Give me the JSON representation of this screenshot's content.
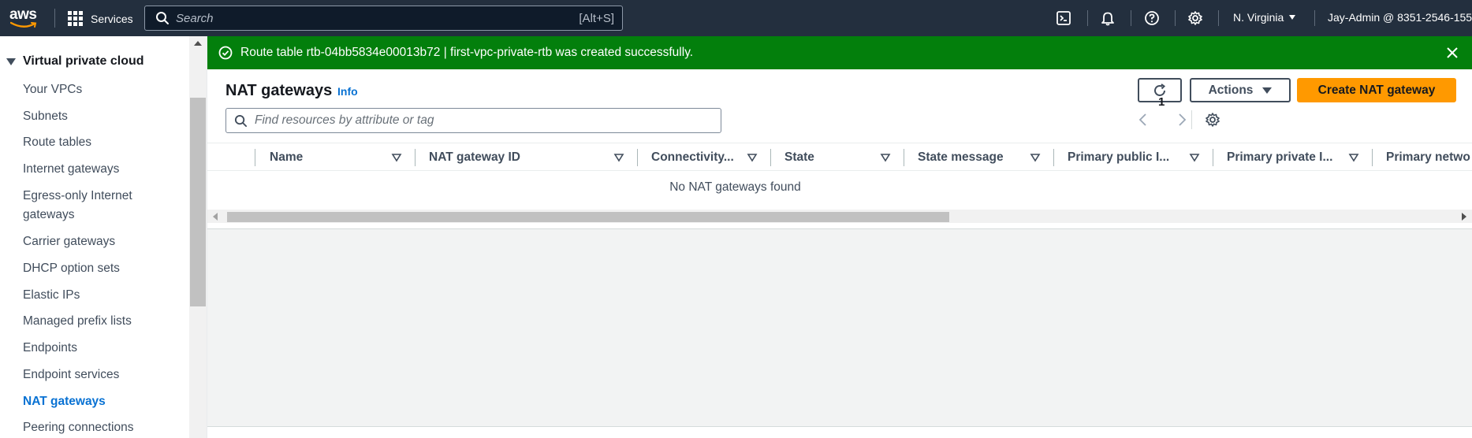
{
  "topnav": {
    "logo_text": "aws",
    "services_label": "Services",
    "search_placeholder": "Search",
    "search_shortcut": "[Alt+S]",
    "region": "N. Virginia",
    "account": "Jay-Admin @ 8351-2546-155"
  },
  "sidebar": {
    "section": "Virtual private cloud",
    "items": [
      {
        "label": "Your VPCs"
      },
      {
        "label": "Subnets"
      },
      {
        "label": "Route tables"
      },
      {
        "label": "Internet gateways"
      },
      {
        "label": "Egress-only Internet"
      },
      {
        "label": "gateways"
      },
      {
        "label": "Carrier gateways"
      },
      {
        "label": "DHCP option sets"
      },
      {
        "label": "Elastic IPs"
      },
      {
        "label": "Managed prefix lists"
      },
      {
        "label": "Endpoints"
      },
      {
        "label": "Endpoint services"
      },
      {
        "label": "NAT gateways"
      },
      {
        "label": "Peering connections"
      }
    ],
    "active": "NAT gateways"
  },
  "flash": {
    "message": "Route table rtb-04bb5834e00013b72 | first-vpc-private-rtb was created successfully.",
    "color": "#037f0c"
  },
  "panel": {
    "title": "NAT gateways",
    "info": "Info",
    "actions_label": "Actions",
    "create_label": "Create NAT gateway",
    "filter_placeholder": "Find resources by attribute or tag",
    "page": "1",
    "columns": [
      "Name",
      "NAT gateway ID",
      "Connectivity...",
      "State",
      "State message",
      "Primary public I...",
      "Primary private I...",
      "Primary netwo"
    ],
    "empty_message": "No NAT gateways found"
  },
  "colors": {
    "nav_bg": "#232f3e",
    "primary_button": "#ff9900",
    "link": "#0972d3"
  }
}
